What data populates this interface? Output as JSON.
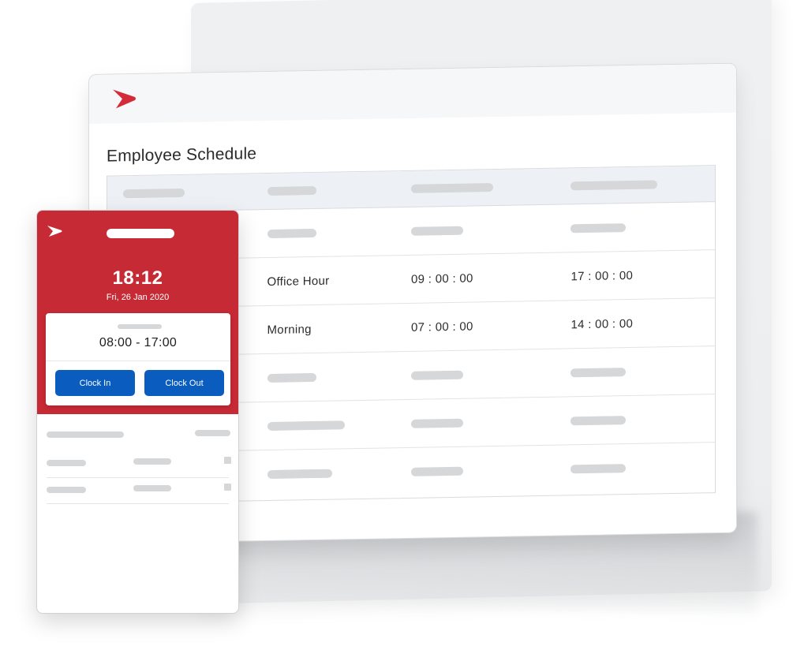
{
  "desktop": {
    "title": "Employee Schedule",
    "rows": [
      {
        "name": "",
        "start": "",
        "end": ""
      },
      {
        "name": "Office Hour",
        "start": "09 : 00 : 00",
        "end": "17 : 00 : 00"
      },
      {
        "name": "Morning",
        "start": "07 : 00 : 00",
        "end": "14 : 00 : 00"
      },
      {
        "name": "",
        "start": "",
        "end": ""
      },
      {
        "name": "",
        "start": "",
        "end": ""
      },
      {
        "name": "",
        "start": "",
        "end": ""
      }
    ]
  },
  "mobile": {
    "time": "18:12",
    "date": "Fri, 26 Jan 2020",
    "shift_range": "08:00 - 17:00",
    "clock_in_label": "Clock In",
    "clock_out_label": "Clock Out"
  },
  "colors": {
    "brand_red": "#c62a35",
    "button_blue": "#0b5cbf",
    "table_header_bg": "#edf1f5"
  }
}
